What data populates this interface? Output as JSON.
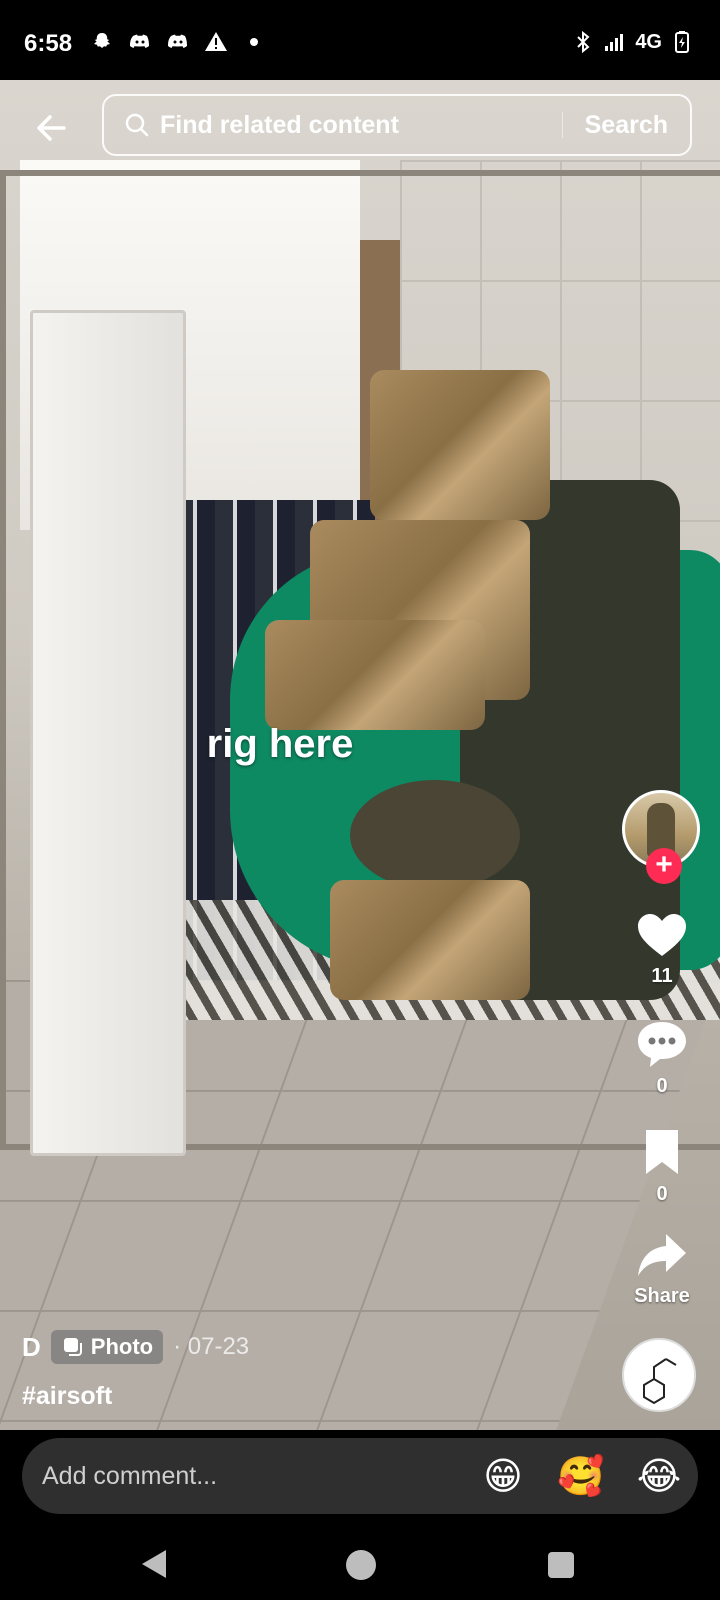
{
  "status_bar": {
    "time": "6:58",
    "left_icons": [
      "snapchat-icon",
      "discord-icon",
      "discord-icon",
      "warning-icon",
      "dot-icon"
    ],
    "network": "4G",
    "right_icons": [
      "bluetooth-icon",
      "signal-icon",
      "battery-icon"
    ]
  },
  "search": {
    "placeholder": "Find related content",
    "button": "Search"
  },
  "post": {
    "caption": "rig here",
    "username": "D",
    "type_badge": "Photo",
    "date": "· 07-23",
    "hashtag": "#airsoft"
  },
  "actions": {
    "likes": "11",
    "comments": "0",
    "saves": "0",
    "share_label": "Share"
  },
  "comment_bar": {
    "placeholder": "Add comment...",
    "emojis": [
      "😁",
      "🥰",
      "😂"
    ]
  },
  "colors": {
    "accent": "#fe2c55",
    "comment_bg": "#2f2f2f"
  }
}
